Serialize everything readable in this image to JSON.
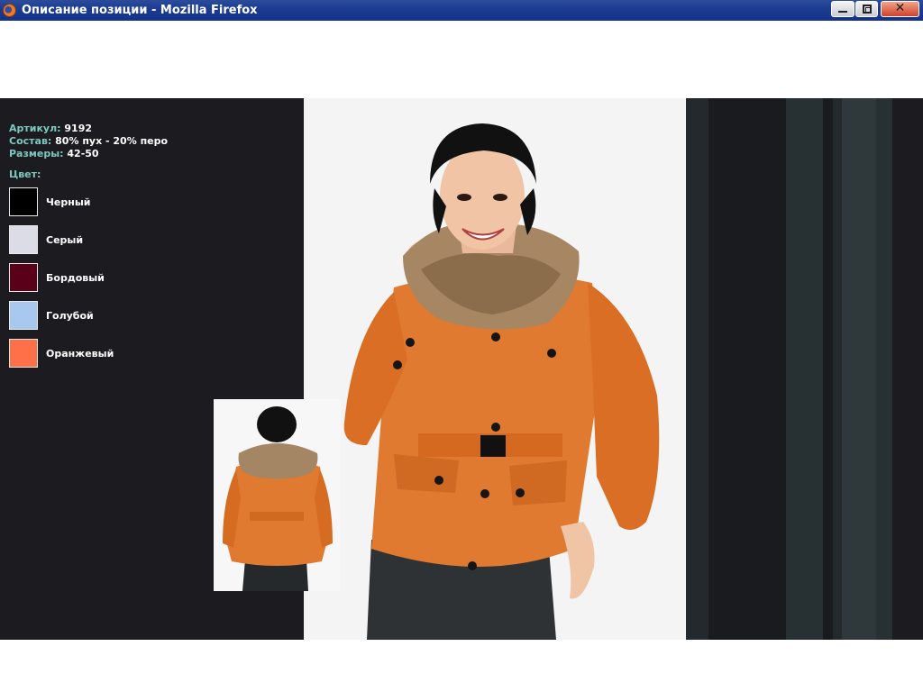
{
  "window": {
    "title": "Описание позиции - Mozilla Firefox"
  },
  "product": {
    "article_label": "Артикул:",
    "article_value": "9192",
    "composition_label": "Состав:",
    "composition_value": "80% пух - 20% перо",
    "sizes_label": "Размеры:",
    "sizes_value": "42-50",
    "color_heading": "Цвет:"
  },
  "colors": [
    {
      "label": "Черный",
      "hex": "#000000"
    },
    {
      "label": "Серый",
      "hex": "#dcdce6"
    },
    {
      "label": "Бордовый",
      "hex": "#5a0018"
    },
    {
      "label": "Голубой",
      "hex": "#a8c8f0"
    },
    {
      "label": "Оранжевый",
      "hex": "#ff7048"
    }
  ],
  "theme": {
    "page_bg": "#1c1c20",
    "label_color": "#7ec8c0",
    "jacket_color": "#e07a30",
    "titlebar_color": "#1c3d92"
  }
}
